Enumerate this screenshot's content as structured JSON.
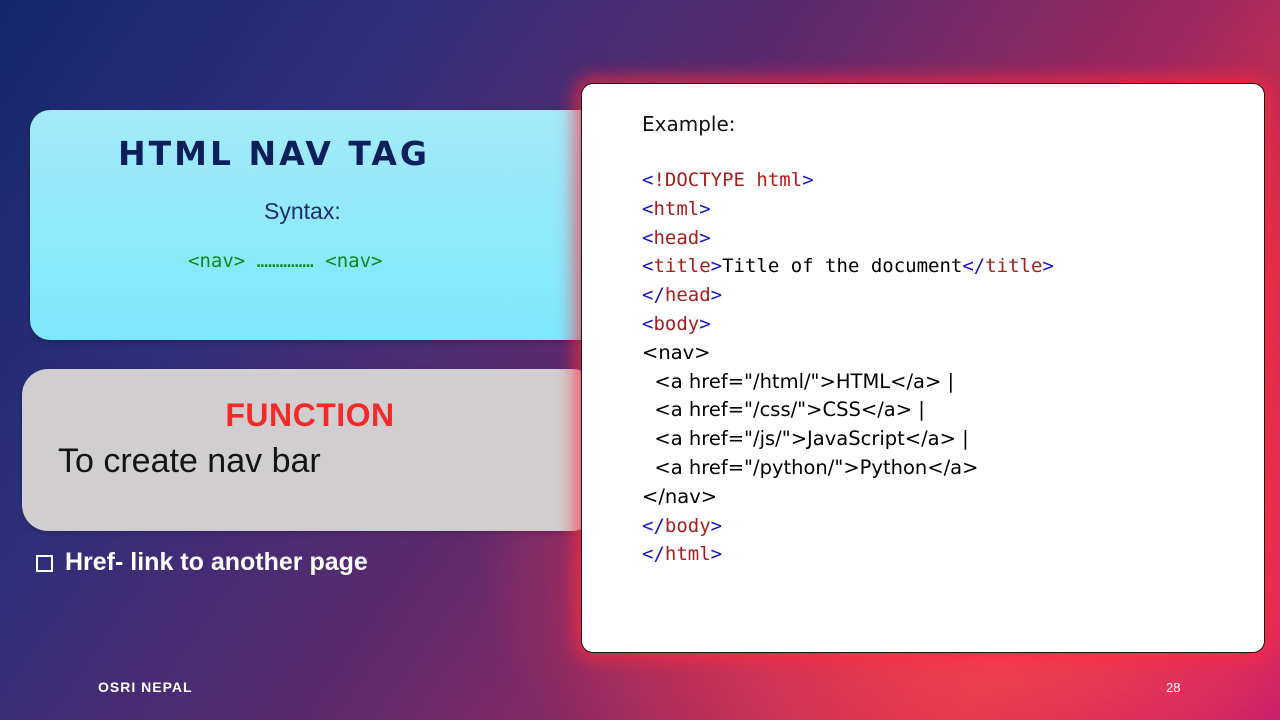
{
  "title_box": {
    "title": "HTML NAV TAG",
    "syntax_label": "Syntax:",
    "syntax_code": "<nav> …………… <nav>"
  },
  "function_box": {
    "heading": "FUNCTION",
    "description": "To create nav bar"
  },
  "bullet": {
    "text": "Href- link to another page",
    "icon": "checkbox-square-icon"
  },
  "code_card": {
    "label": "Example:",
    "lines": [
      {
        "style": "code",
        "segments": [
          {
            "t": "<",
            "c": "br"
          },
          {
            "t": "!DOCTYPE",
            "c": "tg"
          },
          {
            "t": " ",
            "c": "tx"
          },
          {
            "t": "html",
            "c": "kw"
          },
          {
            "t": ">",
            "c": "br"
          }
        ]
      },
      {
        "style": "code",
        "segments": [
          {
            "t": "<",
            "c": "br"
          },
          {
            "t": "html",
            "c": "tg"
          },
          {
            "t": ">",
            "c": "br"
          }
        ]
      },
      {
        "style": "code",
        "segments": [
          {
            "t": "<",
            "c": "br"
          },
          {
            "t": "head",
            "c": "tg"
          },
          {
            "t": ">",
            "c": "br"
          }
        ]
      },
      {
        "style": "code",
        "segments": [
          {
            "t": "<",
            "c": "br"
          },
          {
            "t": "title",
            "c": "tg"
          },
          {
            "t": ">",
            "c": "br"
          },
          {
            "t": "Title of the document",
            "c": "tx"
          },
          {
            "t": "</",
            "c": "br"
          },
          {
            "t": "title",
            "c": "tg"
          },
          {
            "t": ">",
            "c": "br"
          }
        ]
      },
      {
        "style": "code",
        "segments": [
          {
            "t": "</",
            "c": "br"
          },
          {
            "t": "head",
            "c": "tg"
          },
          {
            "t": ">",
            "c": "br"
          }
        ]
      },
      {
        "style": "code",
        "segments": [
          {
            "t": "<",
            "c": "br"
          },
          {
            "t": "body",
            "c": "tg"
          },
          {
            "t": ">",
            "c": "br"
          }
        ]
      },
      {
        "style": "plain",
        "segments": [
          {
            "t": "<nav>",
            "c": "tx"
          }
        ]
      },
      {
        "style": "plain",
        "segments": [
          {
            "t": "  <a href=\"/html/\">HTML</a> |",
            "c": "tx"
          }
        ]
      },
      {
        "style": "plain",
        "segments": [
          {
            "t": "  <a href=\"/css/\">CSS</a> |",
            "c": "tx"
          }
        ]
      },
      {
        "style": "plain",
        "segments": [
          {
            "t": "  <a href=\"/js/\">JavaScript</a> |",
            "c": "tx"
          }
        ]
      },
      {
        "style": "plain",
        "segments": [
          {
            "t": "  <a href=\"/python/\">Python</a>",
            "c": "tx"
          }
        ]
      },
      {
        "style": "plain",
        "segments": [
          {
            "t": "</nav>",
            "c": "tx"
          }
        ]
      },
      {
        "style": "code",
        "segments": [
          {
            "t": "</",
            "c": "br"
          },
          {
            "t": "body",
            "c": "tg"
          },
          {
            "t": ">",
            "c": "br"
          }
        ]
      },
      {
        "style": "code",
        "segments": [
          {
            "t": "</",
            "c": "br"
          },
          {
            "t": "html",
            "c": "tg"
          },
          {
            "t": ">",
            "c": "br"
          }
        ]
      }
    ]
  },
  "footer": {
    "org": "OSRI NEPAL",
    "page_number": "28"
  },
  "colors": {
    "title_text": "#0f1f5c",
    "syntax_code": "#12861a",
    "function_heading": "#f42a2a",
    "code_bracket": "#1414c8",
    "code_tag": "#a51d1d",
    "code_keyword": "#c01414"
  }
}
